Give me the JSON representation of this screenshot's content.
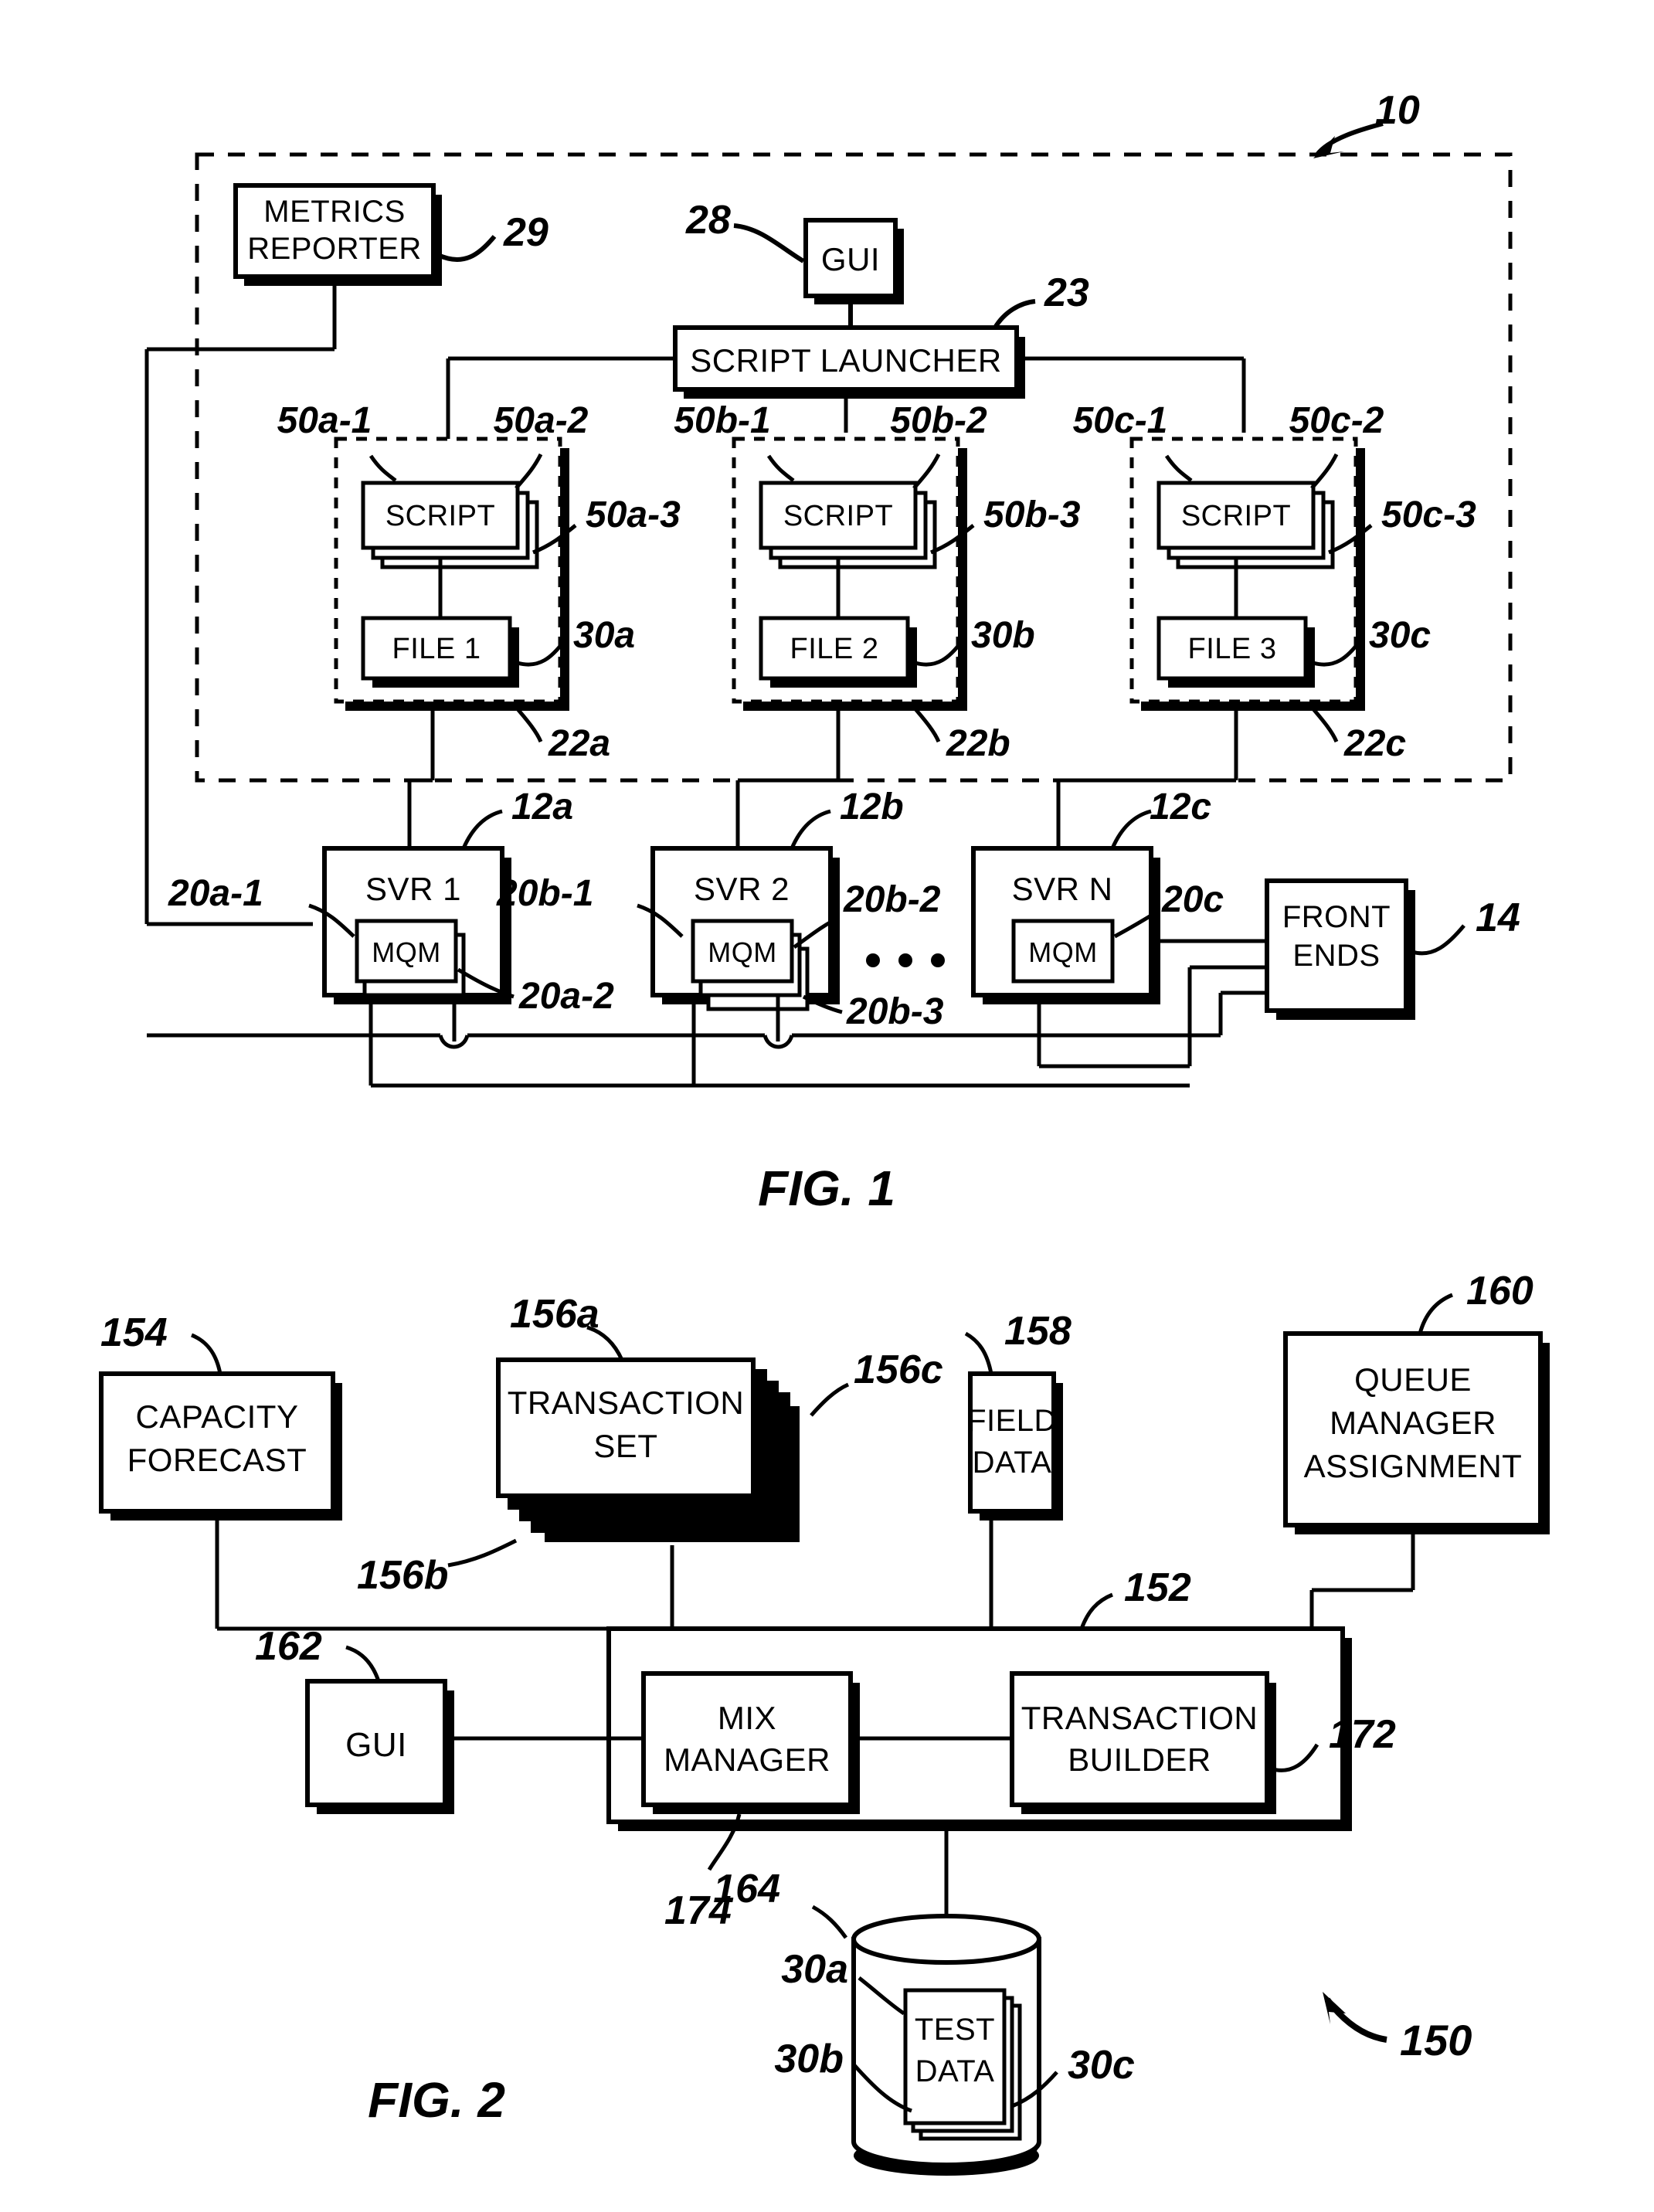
{
  "document": {
    "type": "patent-drawing-sheet",
    "figures": [
      "FIG. 1",
      "FIG. 2"
    ]
  },
  "fig1": {
    "caption": "FIG. 1",
    "system_ref": "10",
    "dashed_boundary_ref": "10",
    "blocks": {
      "metrics_reporter": {
        "label_line1": "METRICS",
        "label_line2": "REPORTER",
        "ref": "29"
      },
      "gui": {
        "label": "GUI",
        "ref": "28"
      },
      "script_launcher": {
        "label": "SCRIPT LAUNCHER",
        "ref": "23"
      },
      "front_ends": {
        "label_line1": "FRONT",
        "label_line2": "ENDS",
        "ref": "14"
      }
    },
    "script_groups": [
      {
        "group_ref": "22a",
        "script_label": "SCRIPT",
        "script_refs": [
          "50a-1",
          "50a-2",
          "50a-3"
        ],
        "file_label": "FILE 1",
        "file_ref": "30a"
      },
      {
        "group_ref": "22b",
        "script_label": "SCRIPT",
        "script_refs": [
          "50b-1",
          "50b-2",
          "50b-3"
        ],
        "file_label": "FILE 2",
        "file_ref": "30b"
      },
      {
        "group_ref": "22c",
        "script_label": "SCRIPT",
        "script_refs": [
          "50c-1",
          "50c-2",
          "50c-3"
        ],
        "file_label": "FILE 3",
        "file_ref": "30c"
      }
    ],
    "servers": [
      {
        "label": "SVR 1",
        "ref": "12a",
        "mqm_label": "MQM",
        "mqm_refs": [
          "20a-1",
          "20a-2"
        ]
      },
      {
        "label": "SVR 2",
        "ref": "12b",
        "mqm_label": "MQM",
        "mqm_refs": [
          "20b-1",
          "20b-2",
          "20b-3"
        ]
      },
      {
        "label": "SVR N",
        "ref": "12c",
        "mqm_label": "MQM",
        "mqm_refs": [
          "20c"
        ]
      }
    ],
    "ellipsis": "• • •"
  },
  "fig2": {
    "caption": "FIG. 2",
    "system_ref": "150",
    "blocks": {
      "capacity_forecast": {
        "label_line1": "CAPACITY",
        "label_line2": "FORECAST",
        "ref": "154"
      },
      "transaction_set": {
        "label_line1": "TRANSACTION",
        "label_line2": "SET",
        "refs": [
          "156a",
          "156b",
          "156c"
        ]
      },
      "field_data": {
        "label_line1": "FIELD",
        "label_line2": "DATA",
        "ref": "158"
      },
      "queue_manager_assignment": {
        "label_line1": "QUEUE",
        "label_line2": "MANAGER",
        "label_line3": "ASSIGNMENT",
        "ref": "160"
      },
      "gui": {
        "label": "GUI",
        "ref": "162"
      },
      "container": {
        "ref": "152"
      },
      "mix_manager": {
        "label_line1": "MIX",
        "label_line2": "MANAGER",
        "ref": "174"
      },
      "transaction_builder": {
        "label_line1": "TRANSACTION",
        "label_line2": "BUILDER",
        "ref": "172"
      },
      "database": {
        "ref": "164",
        "label_line1": "TEST",
        "label_line2": "DATA",
        "doc_refs": [
          "30a",
          "30b",
          "30c"
        ]
      }
    }
  },
  "colors": {
    "ink": "#000000",
    "paper": "#ffffff"
  }
}
